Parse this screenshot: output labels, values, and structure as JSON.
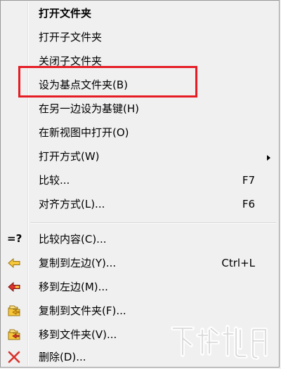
{
  "menu": {
    "items": [
      {
        "label": "打开文件夹",
        "bold": true,
        "icon": null
      },
      {
        "label": "打开子文件夹",
        "icon": null
      },
      {
        "label": "关闭子文件夹",
        "icon": null
      },
      {
        "label": "设为基点文件夹(B)",
        "icon": null
      },
      {
        "label": "在另一边设为基键(H)",
        "icon": null
      },
      {
        "label": "在新视图中打开(O)",
        "icon": null
      },
      {
        "label": "打开方式(W)",
        "icon": null,
        "submenu": true
      },
      {
        "label": "比较...",
        "shortcut": "F7",
        "icon": null
      },
      {
        "label": "对齐方式(L)...",
        "shortcut": "F6",
        "icon": null
      },
      {
        "label": "比较内容(C)...",
        "icon": "equals-question-icon",
        "icon_text": "=?"
      },
      {
        "label": "复制到左边(Y)...",
        "shortcut": "Ctrl+L",
        "icon": "arrow-left-yellow-icon"
      },
      {
        "label": "移到左边(M)...",
        "icon": "arrow-left-red-icon"
      },
      {
        "label": "复制到文件夹(F)...",
        "icon": "folder-copy-icon"
      },
      {
        "label": "移到文件夹(V)...",
        "icon": "folder-move-icon"
      },
      {
        "label": "删除(D)...",
        "icon": "delete-x-icon"
      }
    ]
  },
  "colors": {
    "menu_bg": "#f0f0f0",
    "highlight_border": "#e51c23",
    "folder_yellow": "#f6c63b",
    "delete_red": "#d9342b"
  }
}
